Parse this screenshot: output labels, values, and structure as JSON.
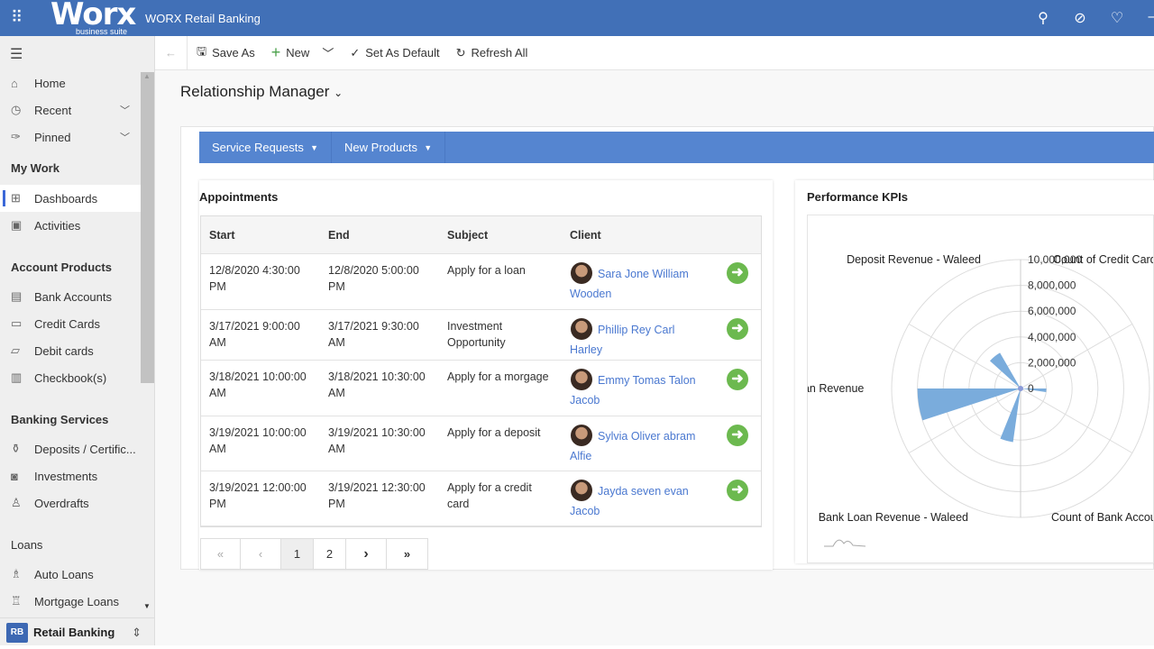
{
  "header": {
    "logo": "Worx",
    "logo_sub": "business suite",
    "app_title": "WORX Retail Banking",
    "icons": [
      "waffle-icon",
      "search-icon",
      "task-icon",
      "lightbulb-icon"
    ]
  },
  "toolbar": {
    "save_as": "Save As",
    "new": "New",
    "set_default": "Set As Default",
    "refresh_all": "Refresh All"
  },
  "page": {
    "title": "Relationship Manager"
  },
  "sidebar": {
    "items": [
      {
        "label": "Home",
        "icon": "home-icon"
      },
      {
        "label": "Recent",
        "icon": "clock-icon"
      },
      {
        "label": "Pinned",
        "icon": "pin-icon"
      }
    ],
    "my_work": "My Work",
    "my_work_items": [
      {
        "label": "Dashboards",
        "icon": "dashboard-icon"
      },
      {
        "label": "Activities",
        "icon": "clipboard-icon"
      }
    ],
    "account_products": "Account Products",
    "account_items": [
      {
        "label": "Bank Accounts"
      },
      {
        "label": "Credit Cards"
      },
      {
        "label": "Debit cards"
      },
      {
        "label": "Checkbook(s)"
      }
    ],
    "banking_services": "Banking Services",
    "banking_items": [
      {
        "label": "Deposits / Certific..."
      },
      {
        "label": "Investments"
      },
      {
        "label": "Overdrafts"
      }
    ],
    "loans": "Loans",
    "loan_items": [
      {
        "label": "Auto Loans"
      },
      {
        "label": "Mortgage Loans"
      }
    ],
    "area": {
      "initials": "RB",
      "label": "Retail Banking"
    }
  },
  "tabs": [
    {
      "label": "Service Requests"
    },
    {
      "label": "New Products"
    }
  ],
  "appointments": {
    "title": "Appointments",
    "columns": [
      "Start",
      "End",
      "Subject",
      "Client"
    ],
    "rows": [
      {
        "start": "12/8/2020 4:30:00 PM",
        "end": "12/8/2020 5:00:00 PM",
        "subject": "Apply for a loan",
        "client": "Sara Jone William Wooden"
      },
      {
        "start": "3/17/2021 9:00:00 AM",
        "end": "3/17/2021 9:30:00 AM",
        "subject": "Investment Opportunity",
        "client": "Phillip Rey Carl Harley"
      },
      {
        "start": "3/18/2021 10:00:00 AM",
        "end": "3/18/2021 10:30:00 AM",
        "subject": "Apply for a morgage",
        "client": "Emmy Tomas Talon Jacob"
      },
      {
        "start": "3/19/2021 10:00:00 AM",
        "end": "3/19/2021 10:30:00 AM",
        "subject": "Apply for a deposit",
        "client": "Sylvia Oliver abram Alfie"
      },
      {
        "start": "3/19/2021 12:00:00 PM",
        "end": "3/19/2021 12:30:00 PM",
        "subject": "Apply for a credit card",
        "client": "Jayda seven evan Jacob"
      }
    ],
    "pager": {
      "first": "«",
      "prev": "‹",
      "pages": [
        "1",
        "2"
      ],
      "current": "1",
      "next": "›",
      "last": "»"
    }
  },
  "kpi": {
    "title": "Performance KPIs"
  },
  "chart_data": {
    "type": "polar-bar",
    "categories": [
      "",
      "Count of Credit Cards",
      "Deposit Revenue - Waleed",
      "Loan Revenue",
      "Bank Loan Revenue - Waleed",
      "Count of Bank Accounts"
    ],
    "category_labels_visible": [
      "",
      "Count of Credit Cards",
      "Deposit Revenue - Waleed",
      "oan Revenue",
      "Bank Loan Revenue - Waleed",
      "Count of Bank Accour"
    ],
    "values": [
      2000000,
      0,
      3200000,
      8000000,
      4200000,
      0
    ],
    "rlim": [
      0,
      10000000
    ],
    "ticks": [
      "0",
      "2,000,000",
      "4,000,000",
      "6,000,000",
      "8,000,000",
      "10,000,000"
    ],
    "grid": true,
    "color": "#7aacdc"
  }
}
